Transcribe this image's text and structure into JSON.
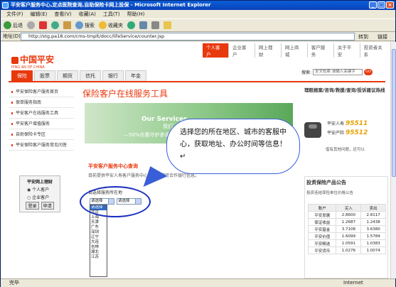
{
  "window": {
    "title": "平安客户服务中心,定点医院查询,自助保险卡网上投保 - Microsoft Internet Explorer",
    "menu": [
      "文件(F)",
      "编辑(E)",
      "查看(V)",
      "收藏(A)",
      "工具(T)",
      "帮助(H)"
    ],
    "toolbar": {
      "back": "后退",
      "search": "搜索",
      "favorites": "收藏夹"
    },
    "address_label": "地址(D)",
    "address": "http://stg.pa18.com/cms-tmplt/docc/lifeService/counter.jsp",
    "goto": "转到",
    "links": "链接",
    "status": "完毕",
    "zone": "Internet"
  },
  "site": {
    "topnav": [
      "个人客户",
      "企业客户",
      "网上理财",
      "网上商城",
      "客户服务",
      "关于平安",
      "投资者关系"
    ],
    "logo_cn": "中国平安",
    "logo_en": "PING AN OF CHINA",
    "channels": [
      "保险",
      "股票",
      "期货",
      "信托",
      "银行",
      "年金"
    ],
    "search_label": "搜索:",
    "search_placeholder": "全文检索 请输入关键字",
    "search_go": "GO"
  },
  "leftnav": [
    "平安保险客户服务首页",
    "保单服务指南",
    "平安客户在线服务工具",
    "平安客户增值服务",
    "自助保险卡专区",
    "平安保险客户服务常见问答"
  ],
  "widget": {
    "title": "平安网上理财",
    "opt1": "个人客户",
    "opt2": "企业客户",
    "login": "登录",
    "apply": "申请"
  },
  "main": {
    "title": "保险客户在线服务工具",
    "banner_t1": "Our Services",
    "banner_t2": "我们",
    "banner_t3": "—50%优惠守护承诺",
    "section": "平安客户服务中心查询",
    "desc": "目前提供平安人寿客户服务中心查询，您可合作银行信息。",
    "sublabel": "请选择服务所在地",
    "sel1": "请选择",
    "sel2": "请选择",
    "dropdown": [
      "请选择",
      "北京",
      "上海",
      "天津",
      "广东",
      "深圳",
      "辽宁",
      "大连",
      "吉林",
      "湖北",
      "江苏"
    ]
  },
  "callout": "选择您的所在地区、城市的客服中心，获取地址、办公时间等信息！↵",
  "right": {
    "title": "理赔报案/咨询/救援/查询/投诉建议热线",
    "hot1_label": "平安人寿",
    "hot1_num": "95511",
    "hot2_label": "平安产险",
    "hot2_num": "95512",
    "hot3": "借有其他问题，还可以",
    "fund_title": "投资保险产品公告",
    "fund_sub": "投资连结保险单位价格公告",
    "fund_headers": [
      "账户",
      "买入",
      "卖出"
    ],
    "fund_rows": [
      [
        "平安发展",
        "2.8600",
        "2.8117"
      ],
      [
        "保证收益",
        "1.2687",
        "1.2438"
      ],
      [
        "平安基金",
        "3.7108",
        "3.6380"
      ],
      [
        "平安价值",
        "1.6099",
        "1.5784"
      ],
      [
        "平安精选",
        "1.0591",
        "1.0383"
      ],
      [
        "平安货币",
        "1.0276",
        "1.0074"
      ]
    ]
  }
}
